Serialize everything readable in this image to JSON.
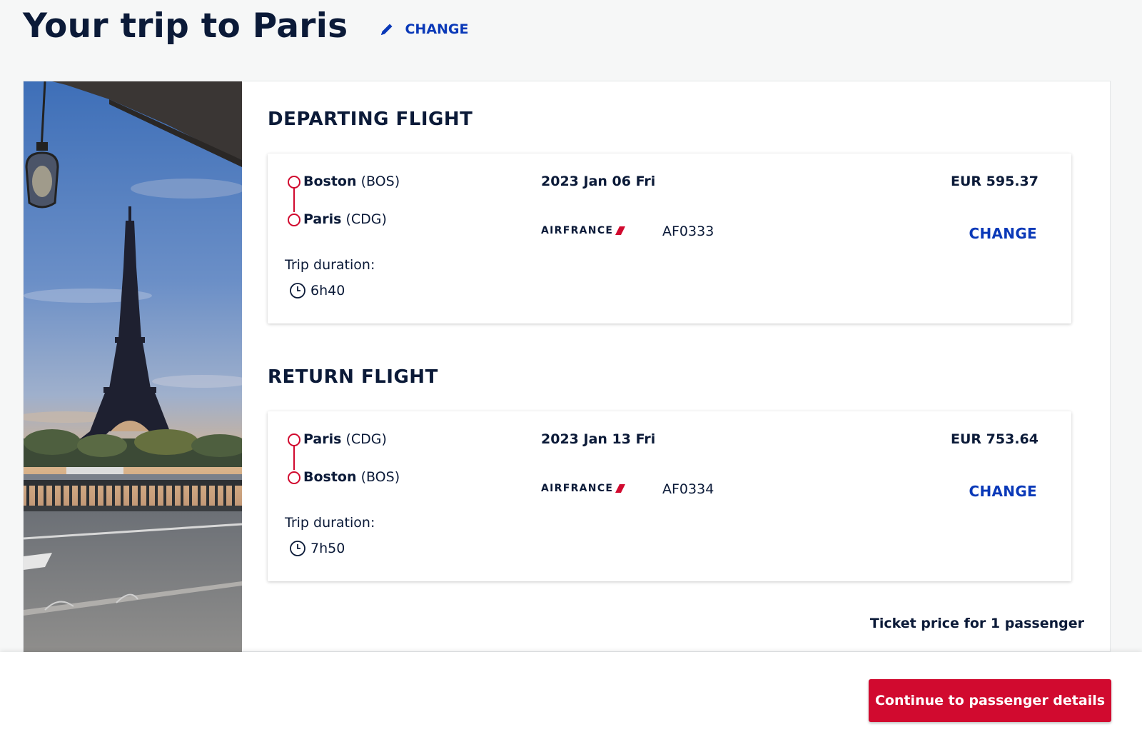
{
  "header": {
    "title": "Your trip to Paris",
    "change_label": "CHANGE"
  },
  "colors": {
    "brand_blue": "#0a39b8",
    "brand_red": "#d10a2f",
    "text_navy": "#0b1a38"
  },
  "departing": {
    "section_title": "DEPARTING FLIGHT",
    "origin_city": "Boston",
    "origin_code": "(BOS)",
    "destination_city": "Paris",
    "destination_code": "(CDG)",
    "duration_label": "Trip duration:",
    "duration": "6h40",
    "date": "2023 Jan 06 Fri",
    "airline": "AIRFRANCE",
    "flight_number": "AF0333",
    "price": "EUR 595.37",
    "change_label": "CHANGE"
  },
  "return": {
    "section_title": "RETURN FLIGHT",
    "origin_city": "Paris",
    "origin_code": "(CDG)",
    "destination_city": "Boston",
    "destination_code": "(BOS)",
    "duration_label": "Trip duration:",
    "duration": "7h50",
    "date": "2023 Jan 13 Fri",
    "airline": "AIRFRANCE",
    "flight_number": "AF0334",
    "price": "EUR 753.64",
    "change_label": "CHANGE"
  },
  "summary": {
    "ticket_price_label": "Ticket price for 1 passenger"
  },
  "footer": {
    "cta_label": "Continue to passenger details"
  },
  "icons": {
    "header_change": "pencil-icon",
    "duration": "clock-icon",
    "airline_mark": "airfrance-stripe-icon"
  }
}
